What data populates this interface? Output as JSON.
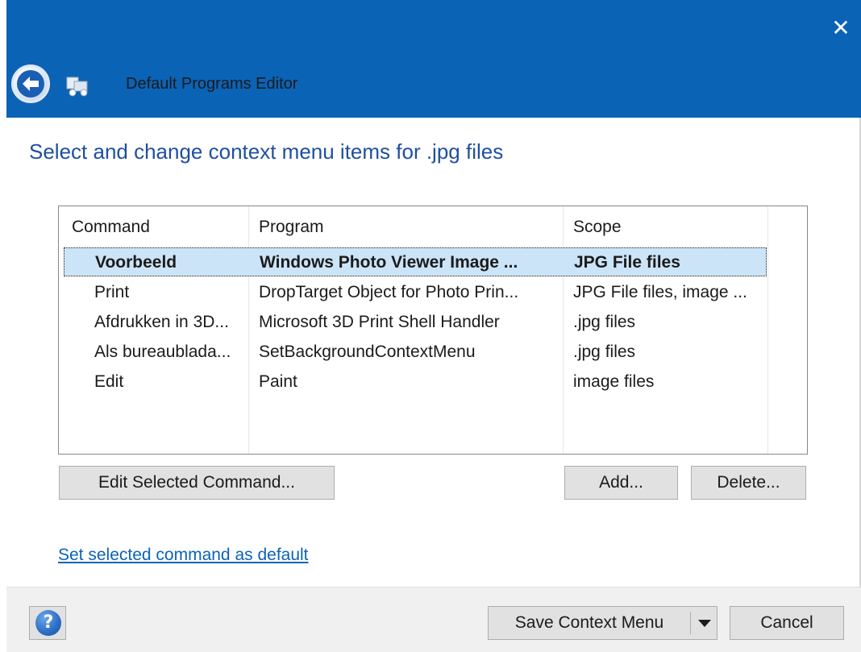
{
  "window": {
    "title": "Default Programs Editor",
    "close_glyph": "✕",
    "heading": "Select and change context menu items for .jpg files"
  },
  "list": {
    "columns": [
      "Command",
      "Program",
      "Scope"
    ],
    "rows": [
      [
        "Voorbeeld",
        "Windows Photo Viewer Image ...",
        "JPG File files"
      ],
      [
        "Print",
        "DropTarget Object for Photo Prin...",
        "JPG File files, image ..."
      ],
      [
        "Afdrukken in 3D...",
        "Microsoft 3D Print Shell Handler",
        ".jpg files"
      ],
      [
        "Als bureaublada...",
        "SetBackgroundContextMenu",
        ".jpg files"
      ],
      [
        "Edit",
        "Paint",
        "image files"
      ]
    ]
  },
  "buttons": {
    "edit": "Edit Selected Command...",
    "add": "Add...",
    "delete": "Delete...",
    "save": "Save Context Menu",
    "cancel": "Cancel",
    "help": "?"
  },
  "link": {
    "set_default": "Set selected command as default"
  },
  "colors": {
    "titlebar": "#0b63b6",
    "heading": "#1f4fa0",
    "selection": "#cce4f7"
  },
  "icons": {
    "back": "back-arrow-icon",
    "app": "default-programs-icon",
    "help": "help-icon",
    "dropdown": "chevron-down-icon"
  }
}
